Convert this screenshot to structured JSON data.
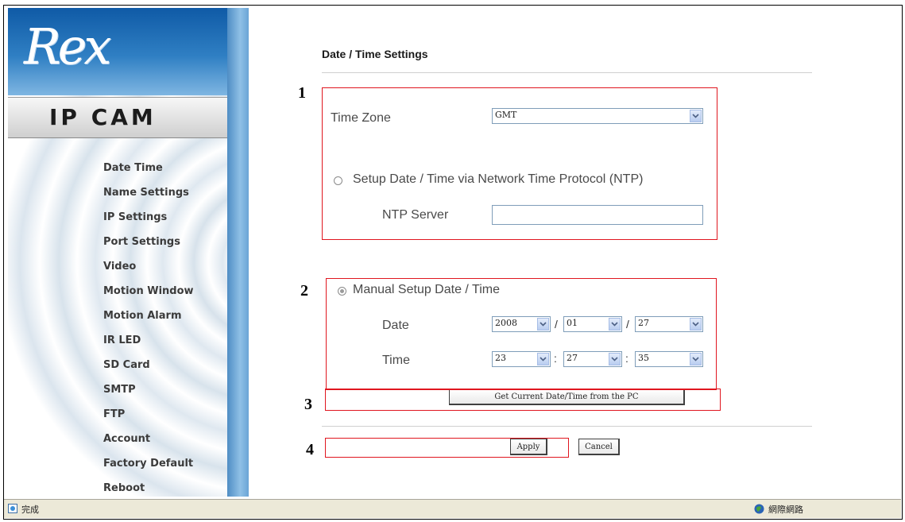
{
  "sidebar": {
    "logo": "Rex",
    "product": "IP CAM",
    "menu": [
      "Date Time",
      "Name Settings",
      "IP Settings",
      "Port Settings",
      "Video",
      "Motion Window",
      "Motion Alarm",
      "IR LED",
      "SD Card",
      "SMTP",
      "FTP",
      "Account",
      "Factory Default",
      "Reboot"
    ]
  },
  "main": {
    "title": "Date / Time Settings",
    "time_zone": {
      "label": "Time Zone",
      "value": "GMT"
    },
    "ntp": {
      "radio_label": "Setup Date / Time via Network Time Protocol (NTP)",
      "radio_checked": false,
      "server_label": "NTP Server",
      "server_value": ""
    },
    "manual": {
      "radio_label": "Manual Setup Date / Time",
      "radio_checked": true,
      "date_label": "Date",
      "year": "2008",
      "month": "01",
      "day": "27",
      "date_sep": "/",
      "time_label": "Time",
      "hour": "23",
      "minute": "27",
      "second": "35",
      "time_sep": ":"
    },
    "sync_button": "Get Current Date/Time from the PC",
    "apply_button": "Apply",
    "cancel_button": "Cancel"
  },
  "annotations": [
    "1",
    "2",
    "3",
    "4"
  ],
  "annotation_color": "#e0161f",
  "statusbar": {
    "status": "完成",
    "zone": "網際網路"
  }
}
